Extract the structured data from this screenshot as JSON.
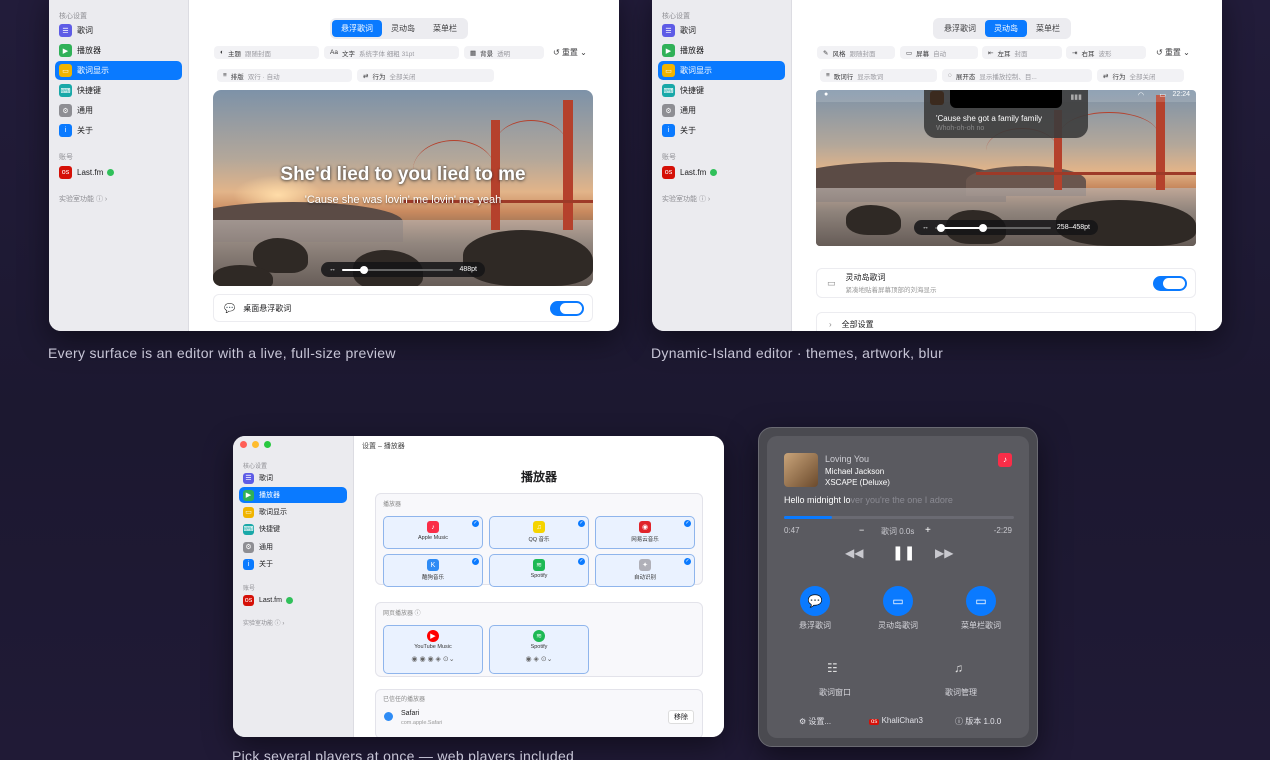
{
  "window1": {
    "sidebar": {
      "section_core": "核心设置",
      "items": [
        {
          "label": "歌词",
          "color": "#5e5ce6",
          "icon": "lyrics-icon"
        },
        {
          "label": "播放器",
          "color": "#30b158",
          "icon": "player-icon"
        },
        {
          "label": "歌词显示",
          "color": "#f0b400",
          "icon": "display-icon",
          "selected": true
        },
        {
          "label": "快捷键",
          "color": "#19a8a8",
          "icon": "keyboard-icon"
        },
        {
          "label": "通用",
          "color": "#8e8e93",
          "icon": "gear-icon"
        },
        {
          "label": "关于",
          "color": "#0a7aff",
          "icon": "info-icon"
        }
      ],
      "section_account": "账号",
      "account": "Last.fm",
      "experimental": "实验室功能 ⓘ ›"
    },
    "tabs": [
      "悬浮歌词",
      "灵动岛",
      "菜单栏"
    ],
    "active_tab": 0,
    "chips_row1": [
      {
        "icon": "◐",
        "label": "主题",
        "value": "跟随封面"
      },
      {
        "icon": "Aa",
        "label": "文字",
        "value": "系统字体 细粗 31pt"
      },
      {
        "icon": "▦",
        "label": "背景",
        "value": "透明"
      }
    ],
    "chips_row2": [
      {
        "icon": "≡",
        "label": "排版",
        "value": "双行 · 自动"
      },
      {
        "icon": "⇄",
        "label": "行为",
        "value": "全部关闭"
      }
    ],
    "reset": "↺ 重置 ⌄",
    "lyric_line1": "She'd lied to you lied to me",
    "lyric_line2": "'Cause she was lovin' me lovin' me yeah",
    "slider_value": "488pt",
    "toggle_label": "桌面悬浮歌词"
  },
  "window2": {
    "sidebar": {
      "section_core": "核心设置",
      "items": [
        {
          "label": "歌词",
          "color": "#5e5ce6",
          "icon": "lyrics-icon"
        },
        {
          "label": "播放器",
          "color": "#30b158",
          "icon": "player-icon"
        },
        {
          "label": "歌词显示",
          "color": "#f0b400",
          "icon": "display-icon",
          "selected": true
        },
        {
          "label": "快捷键",
          "color": "#19a8a8",
          "icon": "keyboard-icon"
        },
        {
          "label": "通用",
          "color": "#8e8e93",
          "icon": "gear-icon"
        },
        {
          "label": "关于",
          "color": "#0a7aff",
          "icon": "info-icon"
        }
      ],
      "section_account": "账号",
      "account": "Last.fm",
      "experimental": "实验室功能 ⓘ ›"
    },
    "tabs": [
      "悬浮歌词",
      "灵动岛",
      "菜单栏"
    ],
    "active_tab": 1,
    "chips_row1": [
      {
        "icon": "✎",
        "label": "风格",
        "value": "跟随封面"
      },
      {
        "icon": "▭",
        "label": "屏幕",
        "value": "自动"
      },
      {
        "icon": "⇤",
        "label": "左耳",
        "value": "封面"
      },
      {
        "icon": "⇥",
        "label": "右耳",
        "value": "波形"
      }
    ],
    "chips_row2": [
      {
        "icon": "≡",
        "label": "歌词行",
        "value": "显示歌词"
      },
      {
        "icon": "◌",
        "label": "展开态",
        "value": "显示播放控制、目..."
      },
      {
        "icon": "⇄",
        "label": "行为",
        "value": "全部关闭"
      }
    ],
    "reset": "↺ 重置 ⌄",
    "clock": "22:24",
    "island_lyric": "'Cause she got a family family",
    "island_lyric_next": "Whoh-oh-oh no",
    "slider_value": "258–458pt",
    "island_setting_title": "灵动岛歌词",
    "island_setting_sub": "紧凑地贴着屏幕顶部的刘海显示",
    "all_settings": "全部设置"
  },
  "window3": {
    "title": "设置 – 播放器",
    "sidebar": {
      "section_core": "核心设置",
      "items": [
        {
          "label": "歌词",
          "color": "#5e5ce6",
          "icon": "lyrics-icon"
        },
        {
          "label": "播放器",
          "color": "#30b158",
          "icon": "player-icon",
          "selected": true
        },
        {
          "label": "歌词显示",
          "color": "#f0b400",
          "icon": "display-icon"
        },
        {
          "label": "快捷键",
          "color": "#19a8a8",
          "icon": "keyboard-icon"
        },
        {
          "label": "通用",
          "color": "#8e8e93",
          "icon": "gear-icon"
        },
        {
          "label": "关于",
          "color": "#0a7aff",
          "icon": "info-icon"
        }
      ],
      "section_account": "账号",
      "account": "Last.fm",
      "experimental": "实验室功能 ⓘ ›"
    },
    "heading": "播放器",
    "players_section": "播放器",
    "players": [
      {
        "name": "Apple Music",
        "color": "#fa2d48",
        "icon": "♪"
      },
      {
        "name": "QQ 音乐",
        "color": "#f5d400",
        "icon": "♫"
      },
      {
        "name": "网易云音乐",
        "color": "#e0242b",
        "icon": "◉"
      },
      {
        "name": "酷狗音乐",
        "color": "#2f8cf5",
        "icon": "K"
      },
      {
        "name": "Spotify",
        "color": "#1db954",
        "icon": "≋"
      },
      {
        "name": "自动识别",
        "color": "#b0b0b8",
        "icon": "✦"
      }
    ],
    "web_section": "网页播放器 ⓘ",
    "web_players": [
      {
        "name": "YouTube Music",
        "color": "#ff0000",
        "icon": "▶"
      },
      {
        "name": "Spotify",
        "color": "#1db954",
        "icon": "≋"
      }
    ],
    "trusted_section": "已信任的播放器",
    "trusted_name": "Safari",
    "trusted_id": "com.apple.Safari",
    "remove_label": "移除"
  },
  "panel": {
    "song": "Loving You",
    "artist": "Michael Jackson",
    "album": "XSCAPE (Deluxe)",
    "lyric": "Hello midnight lo",
    "lyric_rest": "ver you're the one I adore",
    "progress": 0.21,
    "time_elapsed": "0:47",
    "offset_minus": "−",
    "offset_label": "歌词 0.0s",
    "offset_plus": "+",
    "time_remaining": "-2:29",
    "btn_float": "悬浮歌词",
    "btn_island": "灵动岛歌词",
    "btn_menubar": "菜单栏歌词",
    "btn_window": "歌词窗口",
    "btn_manage": "歌词管理",
    "settings": "设置...",
    "user": "KhaliChan3",
    "version": "版本 1.0.0"
  },
  "captions": {
    "c1": "Every surface is an editor with a live, full-size preview",
    "c2": "Dynamic-Island editor · themes, artwork, blur",
    "c3": "Pick several players at once — web players included"
  }
}
